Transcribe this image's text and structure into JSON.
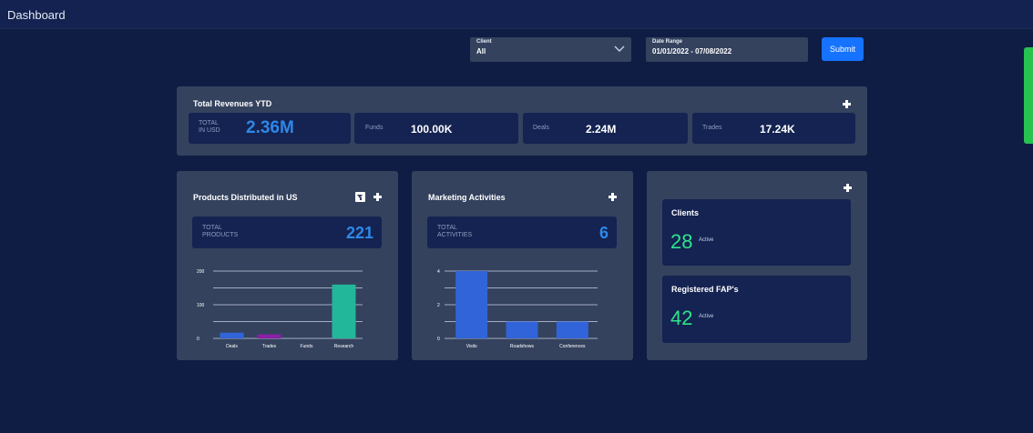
{
  "header": {
    "title": "Dashboard"
  },
  "filters": {
    "client": {
      "label": "Client",
      "value": "All"
    },
    "date_range": {
      "label": "Date Range",
      "value": "01/01/2022 - 07/08/2022"
    },
    "submit_label": "Submit"
  },
  "revenues": {
    "title": "Total Revenues YTD",
    "total": {
      "label_line1": "TOTAL",
      "label_line2": "IN USD",
      "value": "2.36M"
    },
    "funds": {
      "label": "Funds",
      "value": "100.00K"
    },
    "deals": {
      "label": "Deals",
      "value": "2.24M"
    },
    "trades": {
      "label": "Trades",
      "value": "17.24K"
    }
  },
  "products": {
    "title": "Products Distributed in US",
    "total_label_line1": "TOTAL",
    "total_label_line2": "PRODUCTS",
    "total_value": "221"
  },
  "marketing": {
    "title": "Marketing Activities",
    "total_label_line1": "TOTAL",
    "total_label_line2": "ACTIVITIES",
    "total_value": "6"
  },
  "stats": {
    "clients": {
      "label": "Clients",
      "count": "28",
      "status": "Active"
    },
    "faps": {
      "label": "Registered FAP's",
      "count": "42",
      "status": "Active"
    }
  },
  "colors": {
    "accent_blue": "#2f87e8",
    "submit_blue": "#1673ff",
    "active_green": "#2ee48c",
    "side_tab_green": "#27c250"
  },
  "chart_data": [
    {
      "type": "bar",
      "categories": [
        "Deals",
        "Trades",
        "Funds",
        "Research"
      ],
      "values": [
        17,
        12,
        0,
        160
      ],
      "colors": [
        "#3164d8",
        "#8a1fa8",
        "#3164d8",
        "#22b79a"
      ],
      "yticks": [
        0,
        100,
        200
      ],
      "ylim": [
        0,
        200
      ],
      "grid": true
    },
    {
      "type": "bar",
      "categories": [
        "Visits",
        "Roadshows",
        "Conferences"
      ],
      "values": [
        4,
        1,
        1
      ],
      "colors": [
        "#3164d8",
        "#3164d8",
        "#3164d8"
      ],
      "yticks": [
        0,
        2,
        4
      ],
      "ylim": [
        0,
        4
      ],
      "grid": true
    }
  ]
}
